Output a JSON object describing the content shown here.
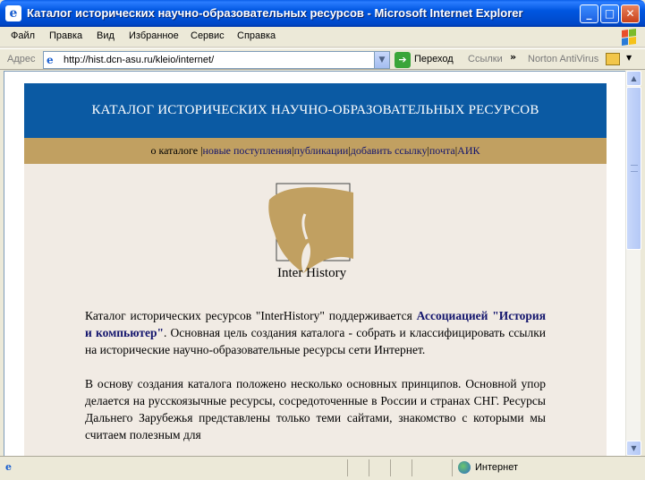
{
  "window": {
    "title": "Каталог исторических научно-образовательных ресурсов - Microsoft Internet Explorer",
    "min_label": "_",
    "max_label": "□",
    "close_label": "✕"
  },
  "menu": {
    "items": [
      "Файл",
      "Правка",
      "Вид",
      "Избранное",
      "Сервис",
      "Справка"
    ]
  },
  "address": {
    "label": "Адрес",
    "url": "http://hist.dcn-asu.ru/kleio/internet/",
    "go_label": "Переход",
    "links_label": "Ссылки",
    "norton_label": "Norton AntiVirus"
  },
  "page": {
    "header": "КАТАЛОГ ИСТОРИЧЕСКИХ НАУЧНО-ОБРАЗОВАТЕЛЬНЫХ РЕСУРСОВ",
    "nav": [
      "о каталоге",
      "новые поступления",
      "публикации",
      "добавить ссылку",
      "почта",
      "АИК"
    ],
    "logo_text": "Inter History",
    "p1_a": "Каталог исторических ресурсов \"InterHistory\" поддерживается ",
    "p1_link": "Ассоциацией \"История и компьютер\"",
    "p1_b": ". Основная цель создания каталога - собрать и классифицировать ссылки на исторические научно-образовательные ресурсы сети Интернет.",
    "p2": "В основу создания каталога положено несколько основных принципов. Основной упор делается на русскоязычные ресурсы, сосредоточенные в России и странах СНГ. Ресурсы Дальнего Зарубежья представлены только теми сайтами, знакомство с которыми мы считаем полезным для"
  },
  "status": {
    "zone": "Интернет"
  },
  "colors": {
    "header_bg": "#0b5aa3",
    "nav_bg": "#c1a061",
    "page_bg": "#f1ebe4",
    "link": "#13156d"
  }
}
